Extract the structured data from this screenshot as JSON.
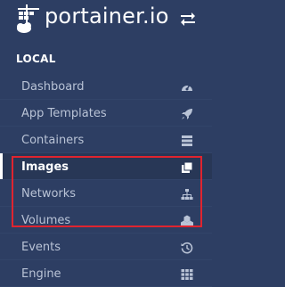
{
  "brand": {
    "name": "portainer.io"
  },
  "section": {
    "title": "LOCAL"
  },
  "nav": {
    "items": [
      {
        "label": "Dashboard",
        "icon": "tachometer-icon"
      },
      {
        "label": "App Templates",
        "icon": "rocket-icon"
      },
      {
        "label": "Containers",
        "icon": "server-icon"
      },
      {
        "label": "Images",
        "icon": "clone-icon",
        "active": true
      },
      {
        "label": "Networks",
        "icon": "sitemap-icon"
      },
      {
        "label": "Volumes",
        "icon": "cubes-icon"
      },
      {
        "label": "Events",
        "icon": "history-icon"
      },
      {
        "label": "Engine",
        "icon": "th-icon"
      }
    ]
  },
  "colors": {
    "sidebar_bg": "#2d3e63",
    "highlight_border": "#e0242f",
    "active_text": "#ffffff",
    "item_text": "#b9c3d6"
  }
}
